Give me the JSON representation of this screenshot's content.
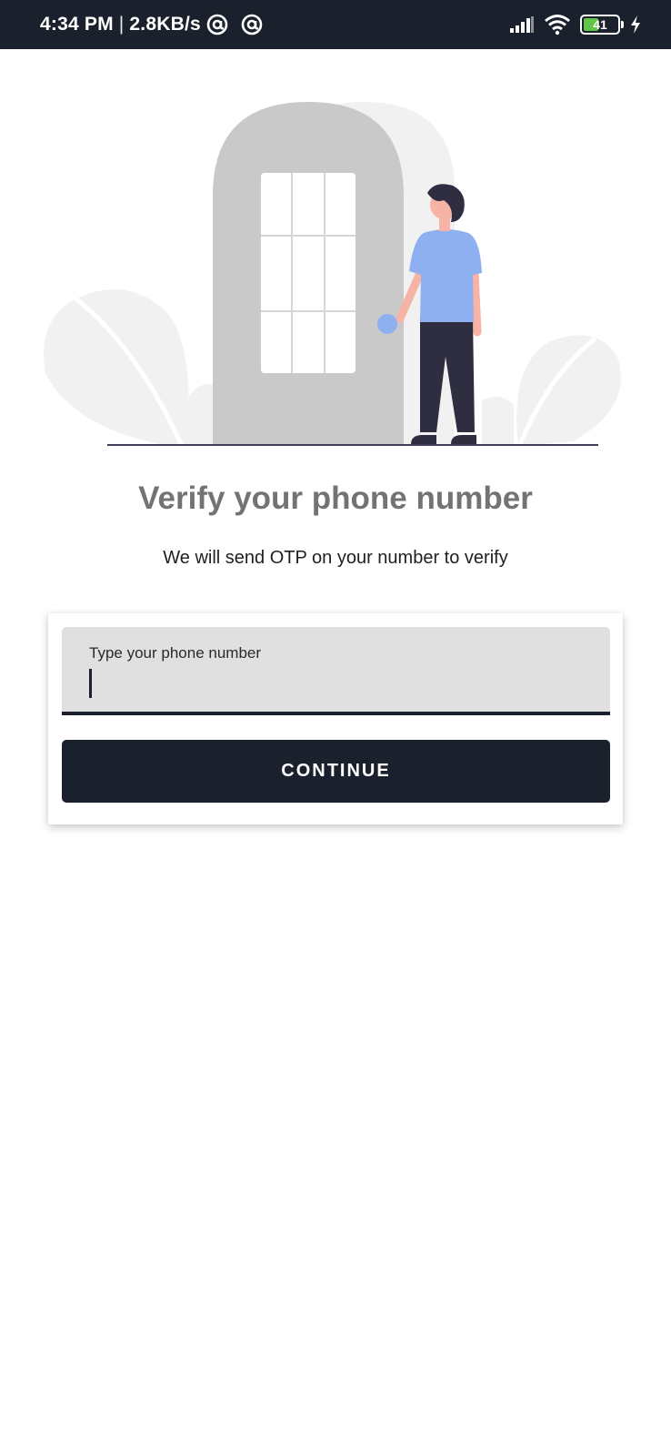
{
  "status_bar": {
    "time": "4:34 PM",
    "separator": "|",
    "network_speed": "2.8KB/s",
    "battery_level": "41",
    "icons": [
      "at-sign-icon",
      "at-sign-icon",
      "signal-icon",
      "wifi-icon",
      "battery-icon",
      "charging-icon"
    ]
  },
  "verify": {
    "title": "Verify your phone number",
    "subtitle": "We will send OTP on your number to verify"
  },
  "form": {
    "phone_label": "Type your phone number",
    "phone_value": "",
    "continue_label": "CONTINUE"
  },
  "colors": {
    "dark": "#1a212c",
    "title": "#737373",
    "field_bg": "#e0e0e1",
    "shirt": "#8fb0f0",
    "door": "#c9c9c9",
    "leaf": "#f1f1f1"
  }
}
